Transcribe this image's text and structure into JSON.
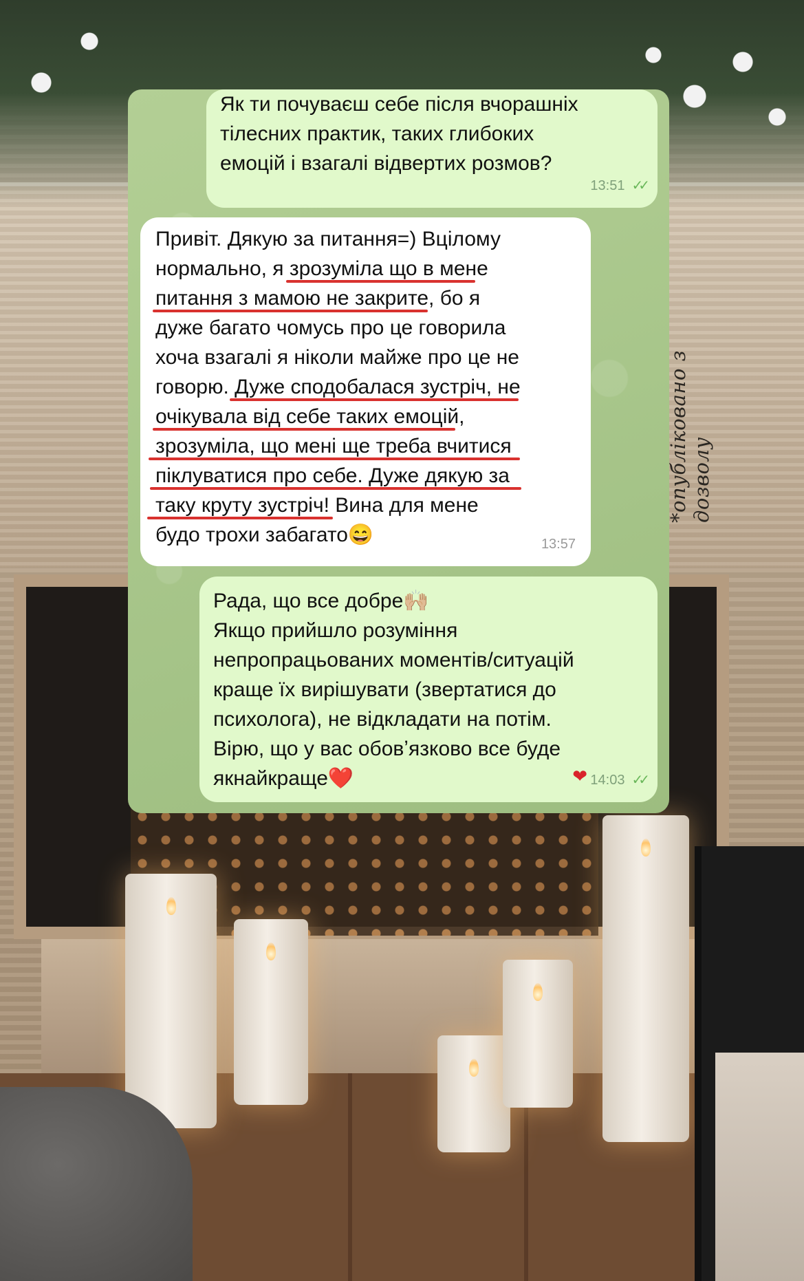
{
  "watermark": "*опубліковано з дозволу",
  "messages": [
    {
      "direction": "outgoing",
      "lines": [
        "Як ти почуваєш себе після вчорашніх",
        "тілесних практик, таких глибоких",
        "емоцій і взагалі відвертих розмов?"
      ],
      "time": "13:51",
      "status_icon": "double-check-icon"
    },
    {
      "direction": "incoming",
      "lines": [
        "Привіт. Дякую за питання=) Вцілому",
        "нормально, я зрозуміла що в мене",
        "питання з мамою не закрите, бо я",
        "дуже багато чомусь про це говорила",
        "хоча взагалі я ніколи майже про це не",
        "говорю. Дуже сподобалася зустріч, не",
        "очікувала від себе таких емоцій,",
        "зрозуміла, що мені ще треба вчитися",
        "піклуватися про себе. Дуже дякую за",
        "таку круту зустріч! Вина для мене",
        "будо трохи забагато😄"
      ],
      "time": "13:57"
    },
    {
      "direction": "outgoing",
      "lines": [
        "Рада, що все добре🙌🏼",
        "Якщо прийшло розуміння",
        "непропрацьованих моментів/ситуацій",
        "краще їх вирішувати (звертатися до",
        "психолога), не відкладати на потім.",
        "Вірю, що у вас обовʼязково все буде",
        "якнайкраще❤️"
      ],
      "time": "14:03",
      "reaction": "❤",
      "status_icon": "double-check-icon"
    }
  ],
  "colors": {
    "outgoing_bubble": "#e1f9cb",
    "incoming_bubble": "#ffffff",
    "chat_background": "#a8c78a",
    "highlight_underline": "#d9322f",
    "read_ticks": "#6ab75a"
  }
}
